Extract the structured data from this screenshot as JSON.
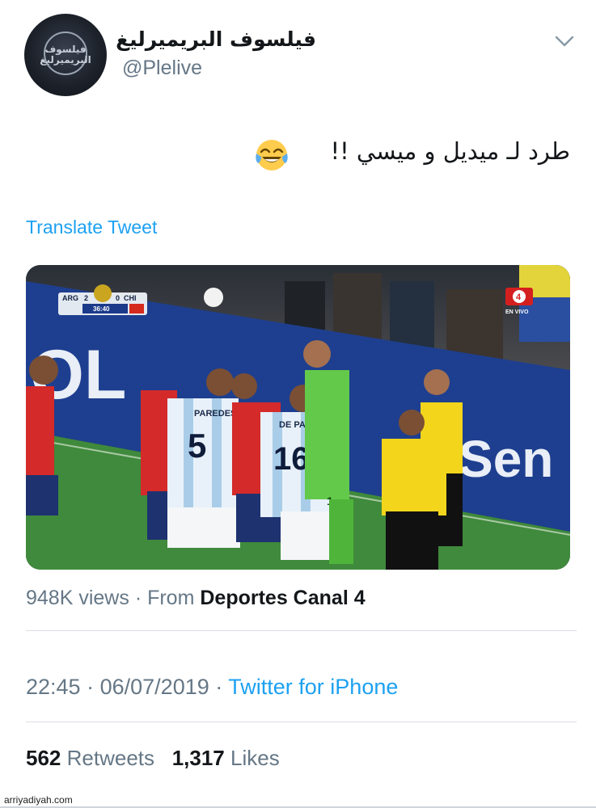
{
  "user": {
    "display_name": "فيلسوف البريميرليغ",
    "handle": "@Plelive",
    "avatar_logo_text": "فيلسوف البريميرليغ"
  },
  "tweet": {
    "text": "طرد لـ ميديل و ميسي !!",
    "emoji": "face-with-tears-of-joy",
    "translate_label": "Translate Tweet"
  },
  "media": {
    "scorebug": {
      "home_team": "ARG",
      "home_score": "2",
      "away_team": "CHI",
      "away_score": "0",
      "clock": "36:40"
    },
    "broadcaster_badge": "4",
    "broadcaster_label": "EN VIVO",
    "ad_board_text": "Sen",
    "player_numbers": [
      "5",
      "16",
      "1"
    ],
    "player_names": [
      "PAREDES",
      "DE PAUL"
    ],
    "colors": {
      "argentina_kit": "#e8f1fa",
      "chile_kit": "#d42a2a",
      "keeper_kit": "#63c94a",
      "referee_kit": "#f3d51c",
      "pitch": "#3f8a3c",
      "ad_board": "#1e3f8f"
    }
  },
  "stats": {
    "views_count": "948K views",
    "from_label": "· From",
    "source_account": "Deportes Canal 4",
    "time": "22:45",
    "date": "06/07/2019",
    "separator": "·",
    "client": "Twitter for iPhone",
    "retweets_count": "562",
    "retweets_label": "Retweets",
    "likes_count": "1,317",
    "likes_label": "Likes"
  },
  "watermark": "arriyadiyah.com",
  "colors": {
    "link_blue": "#1da1f2",
    "secondary_text": "#657786",
    "primary_text": "#14171a",
    "divider": "#d9dee3"
  }
}
